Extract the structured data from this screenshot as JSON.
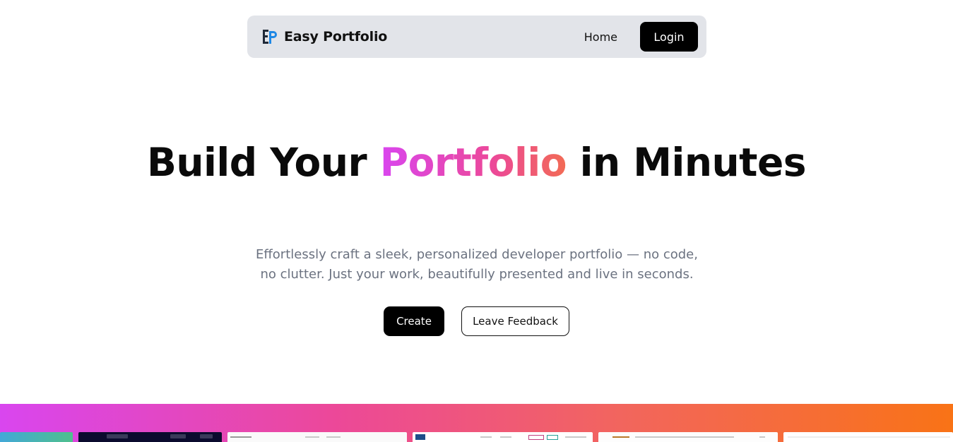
{
  "navbar": {
    "brand_name": "Easy Portfolio",
    "logo_icon": "ep-logo-icon",
    "home_label": "Home",
    "login_label": "Login"
  },
  "hero": {
    "title_before": "Build Your ",
    "title_highlight": "Portfolio",
    "title_after": " in Minutes",
    "subtitle": "Effortlessly craft a sleek, personalized developer portfolio — no code, no clutter. Just your work, beautifully presented and live in seconds.",
    "create_label": "Create",
    "feedback_label": "Leave Feedback"
  },
  "colors": {
    "accent_gradient_start": "#d946ef",
    "accent_gradient_mid": "#ec4899",
    "accent_gradient_end": "#f97316",
    "navbar_bg": "#e2e4e9",
    "button_bg": "#000000"
  }
}
